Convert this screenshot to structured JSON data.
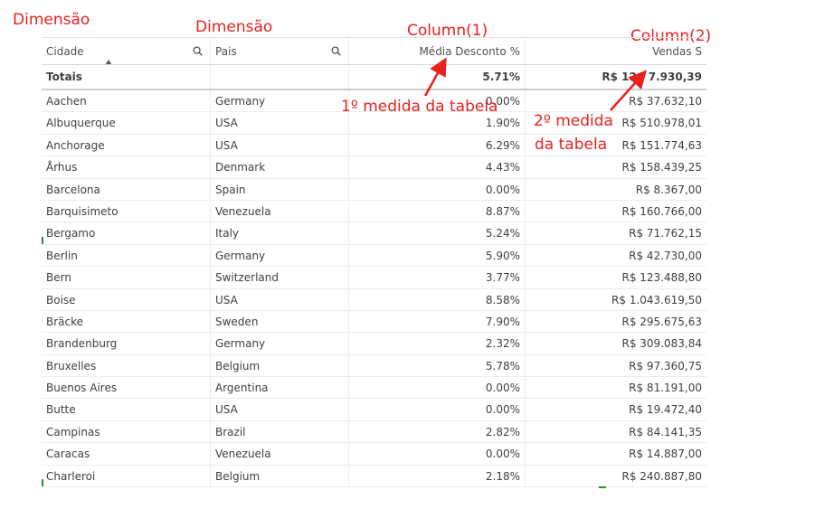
{
  "annotations": {
    "dim1": "Dimensão",
    "dim2": "Dimensão",
    "col1": "Column(1)",
    "col2": "Column(2)",
    "measure1": "1º medida da tabela",
    "measure2_line1": "2º medida",
    "measure2_line2": "da tabela"
  },
  "table": {
    "headers": {
      "cidade": "Cidade",
      "pais": "Pais",
      "media": "Média Desconto %",
      "vendas": "Vendas S"
    },
    "totals": {
      "label": "Totais",
      "pais": "",
      "media": "5.71%",
      "vendas": "R$ 12.  7.930,39"
    },
    "rows": [
      {
        "cidade": "Aachen",
        "pais": "Germany",
        "media": "0.00%",
        "vendas": "R$ 37.632,10"
      },
      {
        "cidade": "Albuquerque",
        "pais": "USA",
        "media": "1.90%",
        "vendas": "R$ 510.978,01"
      },
      {
        "cidade": "Anchorage",
        "pais": "USA",
        "media": "6.29%",
        "vendas": "R$ 151.774,63"
      },
      {
        "cidade": "Århus",
        "pais": "Denmark",
        "media": "4.43%",
        "vendas": "R$ 158.439,25"
      },
      {
        "cidade": "Barcelona",
        "pais": "Spain",
        "media": "0.00%",
        "vendas": "R$ 8.367,00"
      },
      {
        "cidade": "Barquisimeto",
        "pais": "Venezuela",
        "media": "8.87%",
        "vendas": "R$ 160.766,00"
      },
      {
        "cidade": "Bergamo",
        "pais": "Italy",
        "media": "5.24%",
        "vendas": "R$ 71.762,15"
      },
      {
        "cidade": "Berlin",
        "pais": "Germany",
        "media": "5.90%",
        "vendas": "R$ 42.730,00"
      },
      {
        "cidade": "Bern",
        "pais": "Switzerland",
        "media": "3.77%",
        "vendas": "R$ 123.488,80"
      },
      {
        "cidade": "Boise",
        "pais": "USA",
        "media": "8.58%",
        "vendas": "R$ 1.043.619,50"
      },
      {
        "cidade": "Bräcke",
        "pais": "Sweden",
        "media": "7.90%",
        "vendas": "R$ 295.675,63"
      },
      {
        "cidade": "Brandenburg",
        "pais": "Germany",
        "media": "2.32%",
        "vendas": "R$ 309.083,84"
      },
      {
        "cidade": "Bruxelles",
        "pais": "Belgium",
        "media": "5.78%",
        "vendas": "R$ 97.360,75"
      },
      {
        "cidade": "Buenos Aires",
        "pais": "Argentina",
        "media": "0.00%",
        "vendas": "R$ 81.191,00"
      },
      {
        "cidade": "Butte",
        "pais": "USA",
        "media": "0.00%",
        "vendas": "R$ 19.472,40"
      },
      {
        "cidade": "Campinas",
        "pais": "Brazil",
        "media": "2.82%",
        "vendas": "R$ 84.141,35"
      },
      {
        "cidade": "Caracas",
        "pais": "Venezuela",
        "media": "0.00%",
        "vendas": "R$ 14.887,00"
      },
      {
        "cidade": "Charleroi",
        "pais": "Belgium",
        "media": "2.18%",
        "vendas": "R$ 240.887,80"
      }
    ]
  },
  "colors": {
    "annotation": "#e8201e",
    "text": "#404040",
    "grid_line": "#ececec"
  }
}
